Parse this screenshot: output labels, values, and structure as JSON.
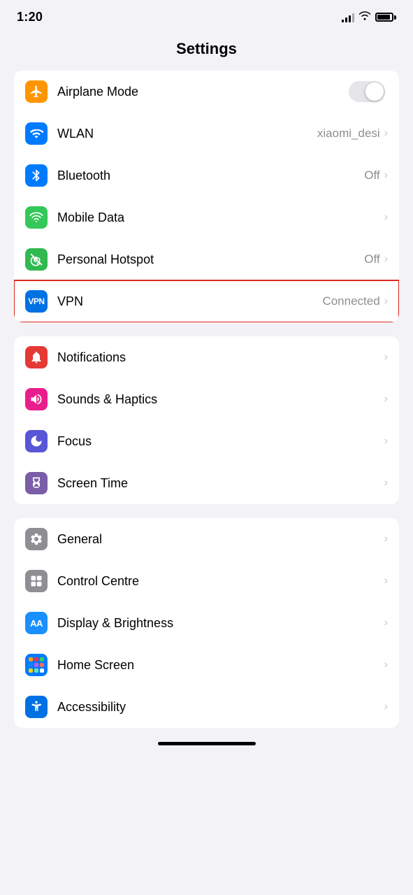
{
  "statusBar": {
    "time": "1:20"
  },
  "pageTitle": "Settings",
  "groups": [
    {
      "id": "connectivity",
      "rows": [
        {
          "id": "airplane-mode",
          "label": "Airplane Mode",
          "iconBg": "bg-orange",
          "iconType": "airplane",
          "rightType": "toggle",
          "value": "",
          "highlighted": false
        },
        {
          "id": "wlan",
          "label": "WLAN",
          "iconBg": "bg-blue",
          "iconType": "wifi",
          "rightType": "value-chevron",
          "value": "xiaomi_desi",
          "highlighted": false
        },
        {
          "id": "bluetooth",
          "label": "Bluetooth",
          "iconBg": "bg-blue",
          "iconType": "bluetooth",
          "rightType": "value-chevron",
          "value": "Off",
          "highlighted": false
        },
        {
          "id": "mobile-data",
          "label": "Mobile Data",
          "iconBg": "bg-green-bright",
          "iconType": "signal",
          "rightType": "chevron",
          "value": "",
          "highlighted": false
        },
        {
          "id": "personal-hotspot",
          "label": "Personal Hotspot",
          "iconBg": "bg-green",
          "iconType": "hotspot",
          "rightType": "value-chevron",
          "value": "Off",
          "highlighted": false
        },
        {
          "id": "vpn",
          "label": "VPN",
          "iconBg": "bg-blue-vpn",
          "iconType": "vpn",
          "rightType": "value-chevron",
          "value": "Connected",
          "highlighted": true
        }
      ]
    },
    {
      "id": "notifications",
      "rows": [
        {
          "id": "notifications",
          "label": "Notifications",
          "iconBg": "bg-red",
          "iconType": "notifications",
          "rightType": "chevron",
          "value": "",
          "highlighted": false
        },
        {
          "id": "sounds-haptics",
          "label": "Sounds & Haptics",
          "iconBg": "bg-pink",
          "iconType": "sound",
          "rightType": "chevron",
          "value": "",
          "highlighted": false
        },
        {
          "id": "focus",
          "label": "Focus",
          "iconBg": "bg-purple",
          "iconType": "moon",
          "rightType": "chevron",
          "value": "",
          "highlighted": false
        },
        {
          "id": "screen-time",
          "label": "Screen Time",
          "iconBg": "bg-purple-dark",
          "iconType": "hourglass",
          "rightType": "chevron",
          "value": "",
          "highlighted": false
        }
      ]
    },
    {
      "id": "general",
      "rows": [
        {
          "id": "general",
          "label": "General",
          "iconBg": "bg-gray",
          "iconType": "gear",
          "rightType": "chevron",
          "value": "",
          "highlighted": false
        },
        {
          "id": "control-centre",
          "label": "Control Centre",
          "iconBg": "bg-gray",
          "iconType": "controls",
          "rightType": "chevron",
          "value": "",
          "highlighted": false
        },
        {
          "id": "display-brightness",
          "label": "Display & Brightness",
          "iconBg": "bg-display-blue",
          "iconType": "display",
          "rightType": "chevron",
          "value": "",
          "highlighted": false
        },
        {
          "id": "home-screen",
          "label": "Home Screen",
          "iconBg": "bg-homescreen",
          "iconType": "homescreen",
          "rightType": "chevron",
          "value": "",
          "highlighted": false
        },
        {
          "id": "accessibility",
          "label": "Accessibility",
          "iconBg": "bg-accessibility",
          "iconType": "accessibility",
          "rightType": "chevron",
          "value": "",
          "highlighted": false
        }
      ]
    }
  ]
}
